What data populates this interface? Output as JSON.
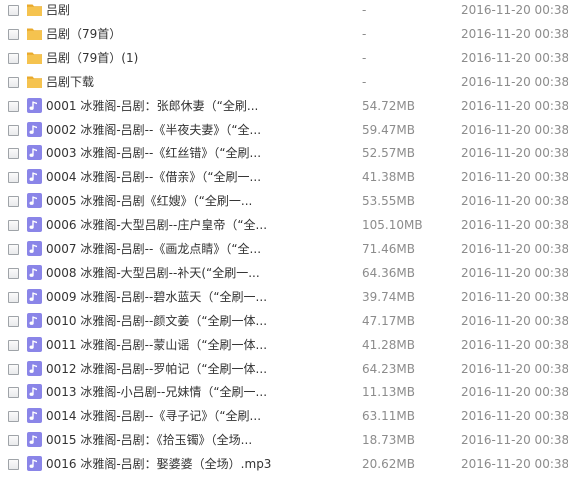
{
  "colors": {
    "folder_body": "#f5c34f",
    "folder_tab": "#e9a92b",
    "audio_icon_bg": "#8a85e8",
    "name_text": "#333333",
    "meta_text": "#8c8c8c"
  },
  "icons": {
    "folder": "folder-icon",
    "audio": "music-note-icon"
  },
  "files": [
    {
      "type": "folder",
      "name": "吕剧",
      "size": "-",
      "date": "2016-11-20 00:38"
    },
    {
      "type": "folder",
      "name": "吕剧（79首）",
      "size": "-",
      "date": "2016-11-20 00:38"
    },
    {
      "type": "folder",
      "name": "吕剧（79首）(1)",
      "size": "-",
      "date": "2016-11-20 00:38"
    },
    {
      "type": "folder",
      "name": "吕剧下载",
      "size": "-",
      "date": "2016-11-20 00:38"
    },
    {
      "type": "audio",
      "name": "0001 冰雅阁-吕剧：张郎休妻（“全刷...",
      "size": "54.72MB",
      "date": "2016-11-20 00:38"
    },
    {
      "type": "audio",
      "name": "0002 冰雅阁-吕剧--《半夜夫妻》（“全...",
      "size": "59.47MB",
      "date": "2016-11-20 00:38"
    },
    {
      "type": "audio",
      "name": "0003 冰雅阁-吕剧--《红丝错》（“全刷...",
      "size": "52.57MB",
      "date": "2016-11-20 00:38"
    },
    {
      "type": "audio",
      "name": "0004 冰雅阁-吕剧--《借亲》（“全刷一...",
      "size": "41.38MB",
      "date": "2016-11-20 00:38"
    },
    {
      "type": "audio",
      "name": "0005 冰雅阁-吕剧《红嫂》（“全刷一...",
      "size": "53.55MB",
      "date": "2016-11-20 00:38"
    },
    {
      "type": "audio",
      "name": "0006 冰雅阁-大型吕剧--庄户皇帝（“全...",
      "size": "105.10MB",
      "date": "2016-11-20 00:38"
    },
    {
      "type": "audio",
      "name": "0007 冰雅阁-吕剧--《画龙点睛》（“全...",
      "size": "71.46MB",
      "date": "2016-11-20 00:38"
    },
    {
      "type": "audio",
      "name": "0008 冰雅阁-大型吕剧--补天(“全刷一...",
      "size": "64.36MB",
      "date": "2016-11-20 00:38"
    },
    {
      "type": "audio",
      "name": "0009 冰雅阁-吕剧--碧水蓝天（“全刷一...",
      "size": "39.74MB",
      "date": "2016-11-20 00:38"
    },
    {
      "type": "audio",
      "name": "0010 冰雅阁-吕剧--颜文姜（“全刷一体...",
      "size": "47.17MB",
      "date": "2016-11-20 00:38"
    },
    {
      "type": "audio",
      "name": "0011 冰雅阁-吕剧--蒙山谣（“全刷一体...",
      "size": "41.28MB",
      "date": "2016-11-20 00:38"
    },
    {
      "type": "audio",
      "name": "0012 冰雅阁-吕剧--罗帕记（“全刷一体...",
      "size": "64.23MB",
      "date": "2016-11-20 00:38"
    },
    {
      "type": "audio",
      "name": "0013 冰雅阁-小吕剧--兄妹情（“全刷一...",
      "size": "11.13MB",
      "date": "2016-11-20 00:38"
    },
    {
      "type": "audio",
      "name": "0014 冰雅阁-吕剧--《寻子记》（“全刷...",
      "size": "63.11MB",
      "date": "2016-11-20 00:38"
    },
    {
      "type": "audio",
      "name": "0015 冰雅阁-吕剧：《拾玉镯》（全场...",
      "size": "18.73MB",
      "date": "2016-11-20 00:38"
    },
    {
      "type": "audio",
      "name": "0016 冰雅阁-吕剧：娶婆婆（全场）.mp3",
      "size": "20.62MB",
      "date": "2016-11-20 00:38"
    }
  ]
}
